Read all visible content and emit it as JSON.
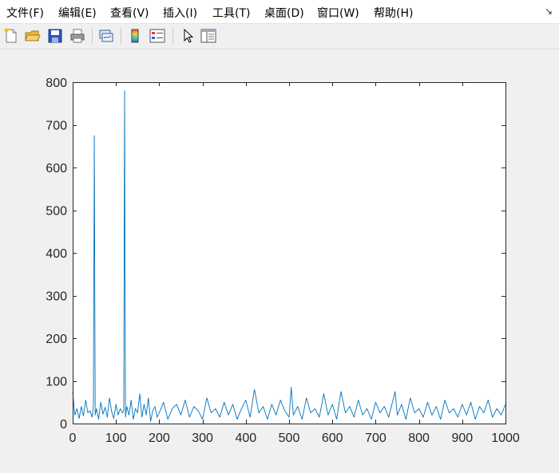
{
  "menubar": {
    "items": [
      "文件(F)",
      "编辑(E)",
      "查看(V)",
      "插入(I)",
      "工具(T)",
      "桌面(D)",
      "窗口(W)",
      "帮助(H)"
    ]
  },
  "toolbar": {
    "buttons": [
      {
        "name": "new-figure-icon"
      },
      {
        "name": "open-file-icon"
      },
      {
        "name": "save-icon"
      },
      {
        "name": "print-icon"
      },
      {
        "name": "link-plot-icon"
      },
      {
        "name": "insert-colorbar-icon"
      },
      {
        "name": "insert-legend-icon"
      },
      {
        "name": "select-pointer-icon"
      },
      {
        "name": "property-inspector-icon"
      }
    ]
  },
  "chart_data": {
    "type": "line",
    "title": "",
    "xlabel": "",
    "ylabel": "",
    "xlim": [
      0,
      1000
    ],
    "ylim": [
      0,
      800
    ],
    "xticks": [
      0,
      100,
      200,
      300,
      400,
      500,
      600,
      700,
      800,
      900,
      1000
    ],
    "yticks": [
      0,
      100,
      200,
      300,
      400,
      500,
      600,
      700,
      800
    ],
    "grid": false,
    "legend": "none",
    "series": [
      {
        "color": "#0072BD",
        "x": [
          0,
          5,
          10,
          15,
          20,
          25,
          30,
          35,
          40,
          45,
          48,
          50,
          52,
          55,
          60,
          65,
          70,
          75,
          80,
          85,
          90,
          95,
          100,
          105,
          110,
          115,
          118,
          120,
          122,
          125,
          130,
          135,
          140,
          145,
          150,
          155,
          160,
          165,
          170,
          175,
          180,
          185,
          190,
          195,
          200,
          210,
          220,
          230,
          240,
          250,
          260,
          270,
          280,
          290,
          300,
          310,
          320,
          330,
          340,
          350,
          360,
          370,
          380,
          390,
          400,
          410,
          420,
          430,
          440,
          450,
          460,
          470,
          480,
          490,
          500,
          505,
          510,
          520,
          530,
          540,
          550,
          560,
          570,
          580,
          590,
          600,
          610,
          620,
          630,
          640,
          650,
          660,
          670,
          680,
          690,
          700,
          710,
          720,
          730,
          740,
          745,
          750,
          760,
          770,
          780,
          790,
          800,
          810,
          820,
          830,
          840,
          850,
          860,
          870,
          880,
          890,
          900,
          910,
          920,
          930,
          940,
          950,
          960,
          970,
          980,
          990,
          1000
        ],
        "y": [
          75,
          20,
          35,
          12,
          40,
          18,
          55,
          25,
          30,
          15,
          45,
          675,
          20,
          35,
          10,
          50,
          22,
          38,
          15,
          60,
          28,
          12,
          45,
          20,
          35,
          25,
          30,
          780,
          15,
          40,
          20,
          55,
          10,
          35,
          25,
          70,
          15,
          45,
          20,
          60,
          5,
          30,
          40,
          15,
          25,
          50,
          10,
          35,
          45,
          20,
          55,
          15,
          40,
          30,
          10,
          60,
          25,
          35,
          15,
          50,
          20,
          45,
          10,
          35,
          55,
          15,
          80,
          25,
          40,
          10,
          45,
          20,
          55,
          30,
          15,
          85,
          20,
          40,
          10,
          60,
          25,
          35,
          15,
          70,
          20,
          45,
          10,
          75,
          25,
          40,
          15,
          55,
          20,
          35,
          10,
          50,
          25,
          40,
          15,
          55,
          75,
          20,
          45,
          10,
          60,
          25,
          35,
          15,
          50,
          20,
          40,
          10,
          55,
          25,
          35,
          15,
          45,
          20,
          50,
          10,
          40,
          25,
          55,
          15,
          35,
          20,
          45
        ]
      }
    ]
  }
}
